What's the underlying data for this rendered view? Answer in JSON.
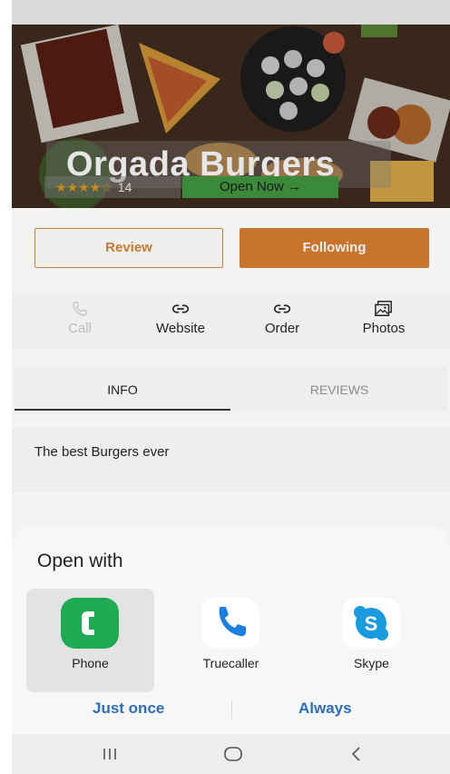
{
  "restaurant": {
    "name": "Orgada Burgers",
    "rating_stars": 4,
    "rating_count": "14",
    "open_status": "Open Now →"
  },
  "buttons": {
    "review": "Review",
    "following": "Following"
  },
  "actions": [
    {
      "label": "Call",
      "icon": "phone-icon",
      "enabled": false
    },
    {
      "label": "Website",
      "icon": "link-icon",
      "enabled": true
    },
    {
      "label": "Order",
      "icon": "link-icon",
      "enabled": true
    },
    {
      "label": "Photos",
      "icon": "photos-icon",
      "enabled": true
    }
  ],
  "tabs": [
    {
      "label": "INFO",
      "active": true
    },
    {
      "label": "REVIEWS",
      "active": false
    }
  ],
  "description": "The best Burgers ever",
  "open_with": {
    "title": "Open with",
    "apps": [
      {
        "label": "Phone",
        "icon": "phone-app-icon",
        "selected": true,
        "color": "#1faa54"
      },
      {
        "label": "Truecaller",
        "icon": "truecaller-icon",
        "selected": false,
        "color": "#1a7fe0"
      },
      {
        "label": "Skype",
        "icon": "skype-icon",
        "selected": false,
        "color": "#1a9be0"
      }
    ],
    "just_once": "Just once",
    "always": "Always"
  },
  "colors": {
    "accent": "#c9742d",
    "link": "#2b6dc0",
    "open_badge": "#3a8a3a"
  }
}
